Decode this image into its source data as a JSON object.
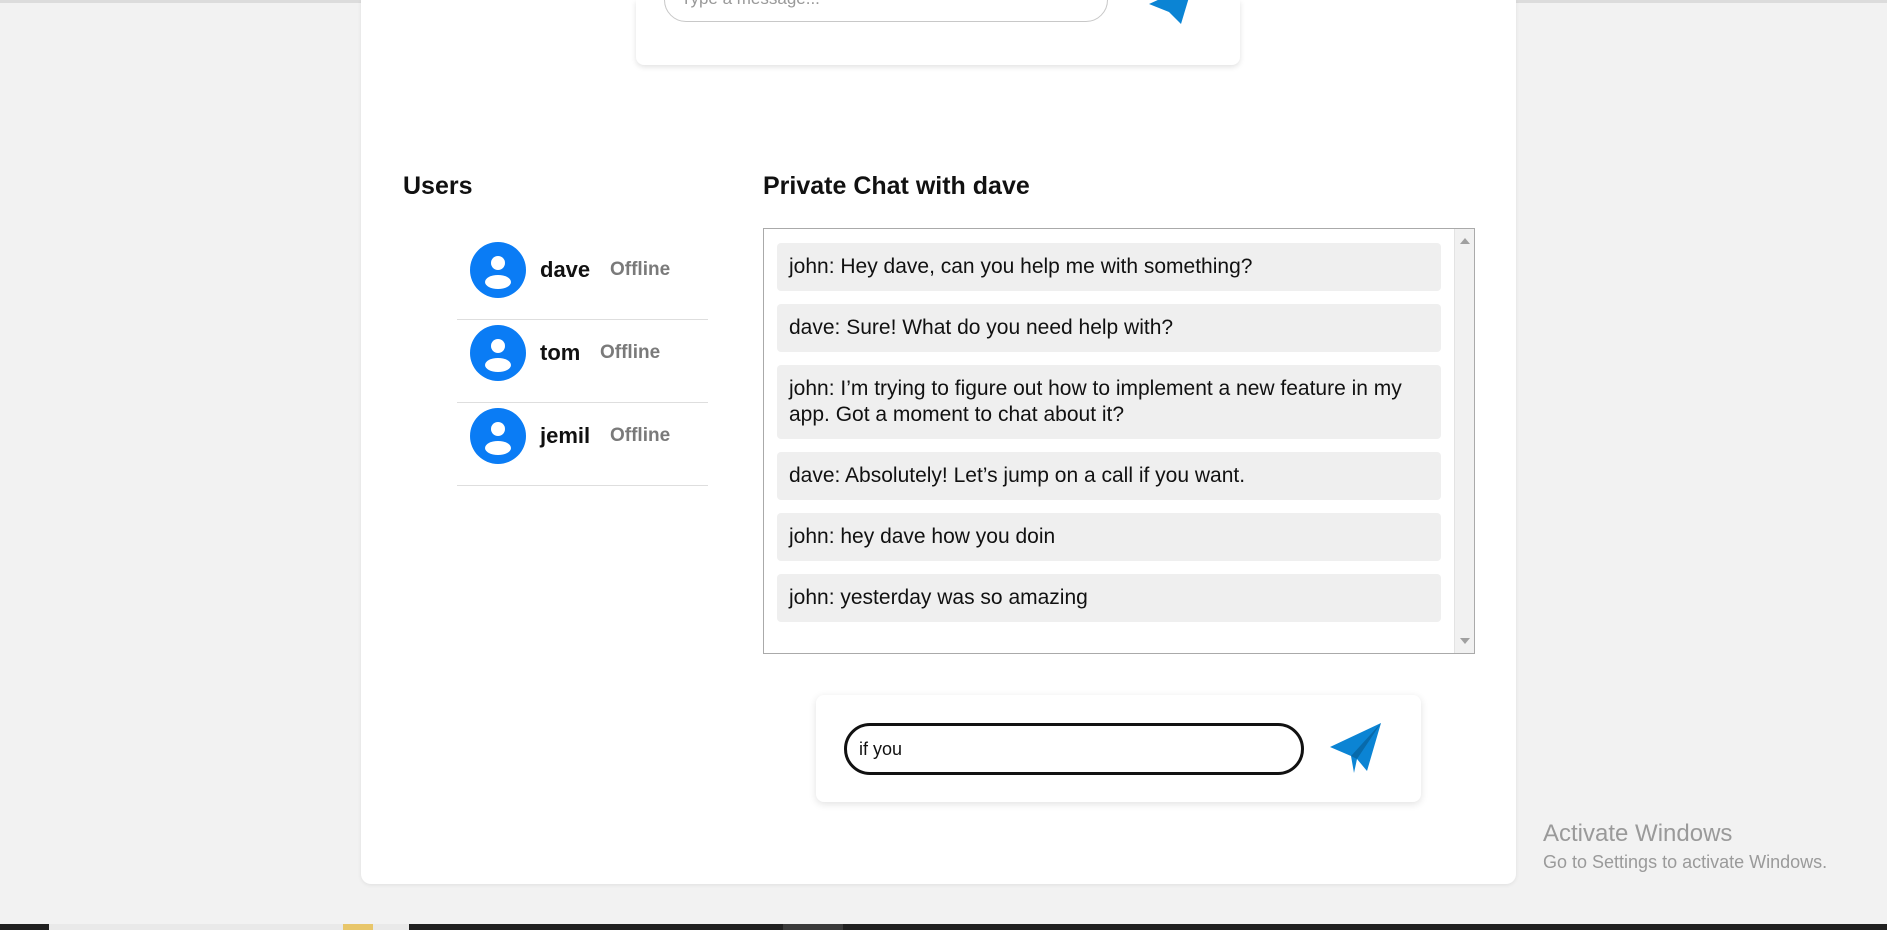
{
  "public_chat": {
    "input_placeholder": "Type a message..."
  },
  "users": {
    "title": "Users",
    "items": [
      {
        "name": "dave",
        "status": "Offline"
      },
      {
        "name": "tom",
        "status": "Offline"
      },
      {
        "name": "jemil",
        "status": "Offline"
      }
    ]
  },
  "chat": {
    "title": "Private Chat with dave",
    "messages": [
      "john: Hey dave, can you help me with something?",
      "dave: Sure! What do you need help with?",
      "john: I’m trying to figure out how to implement a new feature in my app. Got a moment to chat about it?",
      "dave: Absolutely! Let’s jump on a call if you want.",
      "john: hey dave how you doin",
      "john: yesterday was so amazing"
    ],
    "input_value": "if you"
  },
  "colors": {
    "avatar": "#0a7cf5",
    "send_icon": "#0b84d4",
    "status": "#7a7a7a"
  },
  "watermark": {
    "title": "Activate Windows",
    "subtitle": "Go to Settings to activate Windows."
  },
  "icons": {
    "send": "paper-plane-icon",
    "avatar": "user-avatar-icon"
  }
}
